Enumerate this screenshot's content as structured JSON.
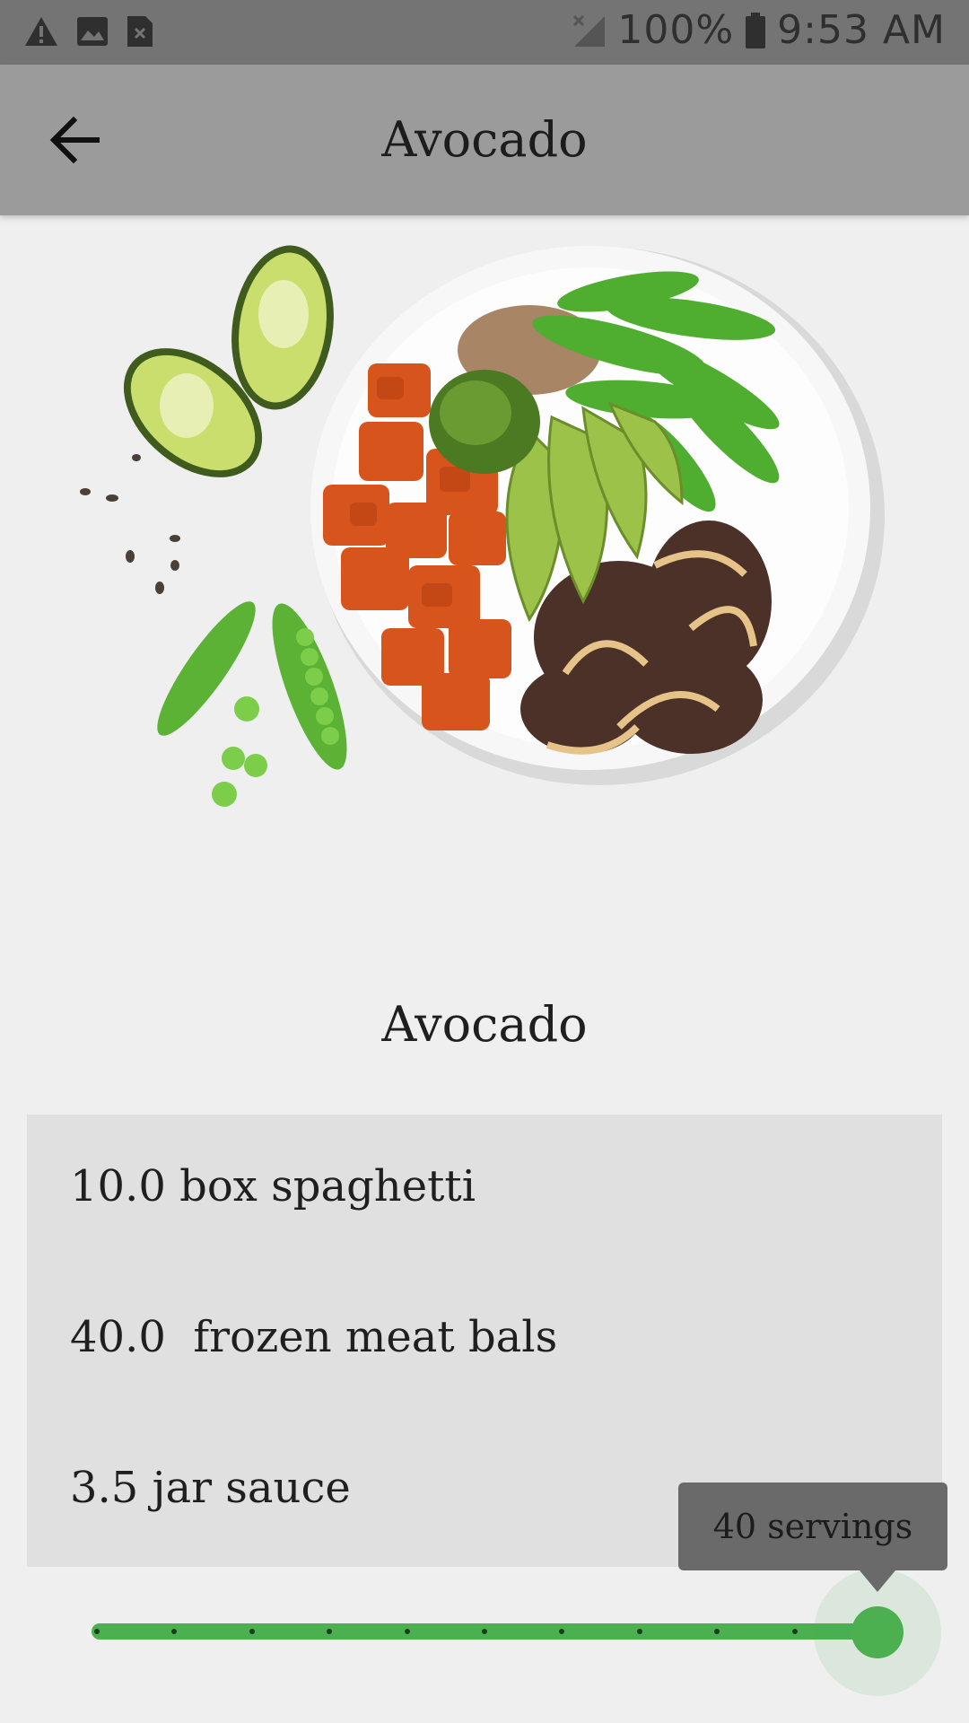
{
  "status_bar": {
    "battery": "100%",
    "time": "9:53 AM",
    "icons": [
      "warning-icon",
      "image-icon",
      "sim-error-icon",
      "no-signal-icon",
      "battery-icon"
    ]
  },
  "app_bar": {
    "title": "Avocado",
    "back_icon": "arrow-left-icon"
  },
  "recipe": {
    "title": "Avocado",
    "image": "avocado-bowl-photo",
    "ingredients": [
      {
        "text": "10.0 box spaghetti"
      },
      {
        "text": "40.0  frozen meat bals"
      },
      {
        "text": "3.5 jar sauce"
      }
    ]
  },
  "servings_slider": {
    "value": 40,
    "label": "40 servings",
    "min": 0,
    "max": 40,
    "step_count": 11,
    "accent": "#4caf50"
  }
}
